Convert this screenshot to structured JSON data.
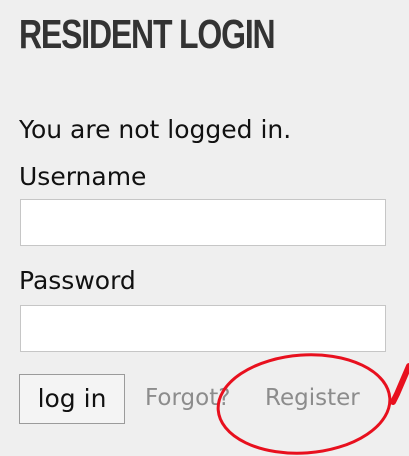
{
  "widget": {
    "title": "RESIDENT LOGIN",
    "status_text": "You are not logged in.",
    "username_label": "Username",
    "username_value": "",
    "password_label": "Password",
    "password_value": "",
    "login_button_label": "log in",
    "forgot_link_label": "Forgot?",
    "register_link_label": "Register"
  },
  "colors": {
    "panel_background": "#efefef",
    "link_gray": "#8c8c8c",
    "annotation_red": "#e8101e"
  }
}
